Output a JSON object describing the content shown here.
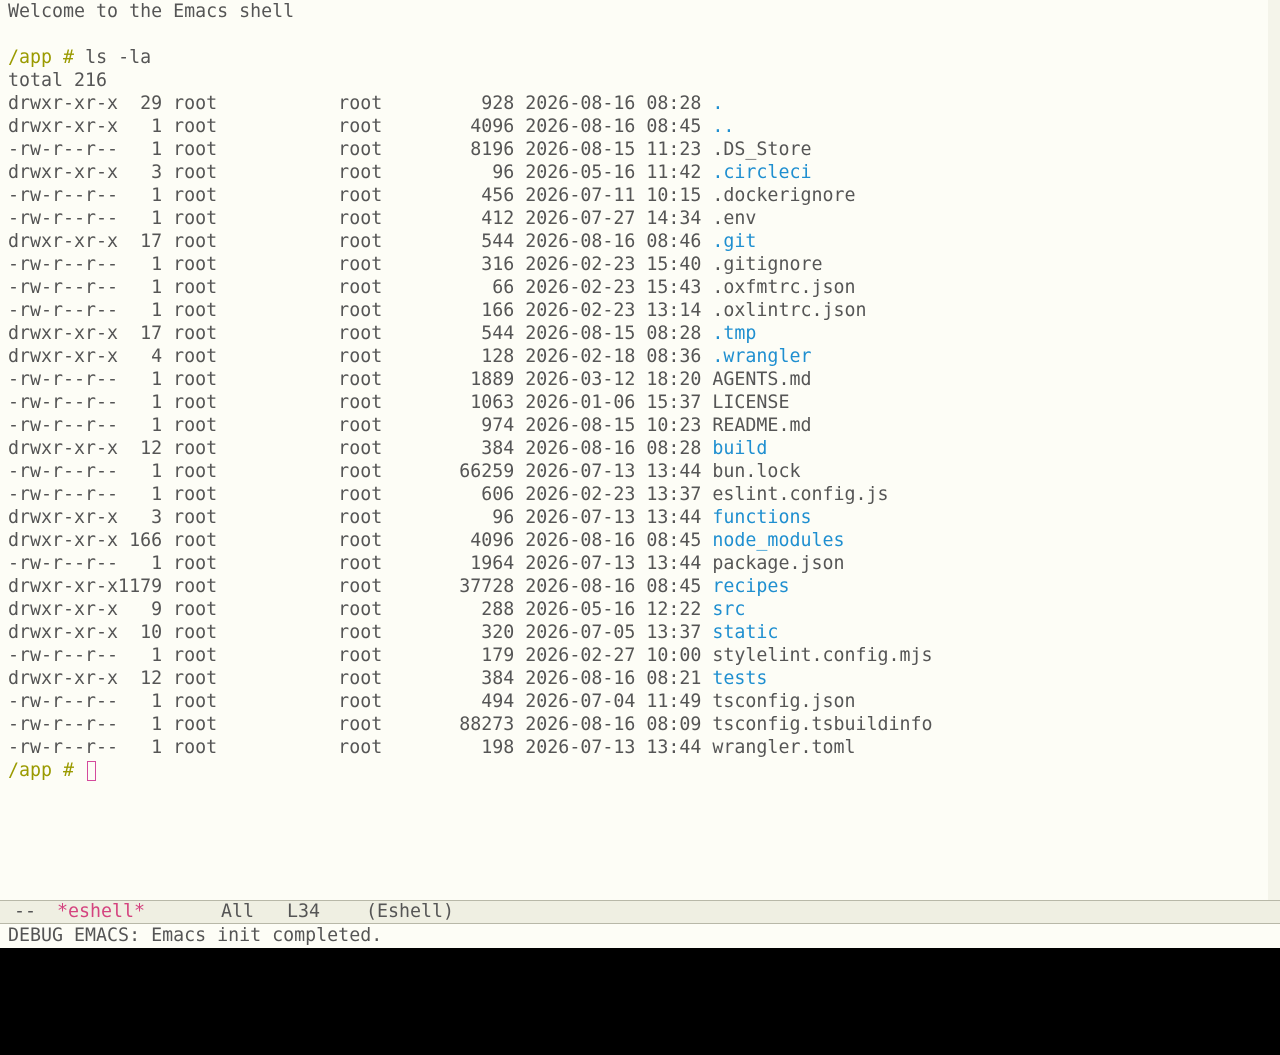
{
  "welcome": "Welcome to the Emacs shell",
  "prompt": "/app #",
  "command": "ls -la",
  "total": "total 216",
  "entries": [
    {
      "perms": "drwxr-xr-x",
      "links": "29",
      "owner": "root",
      "group": "root",
      "size": "928",
      "date": "2026-08-16 08:28",
      "name": ".",
      "dir": true
    },
    {
      "perms": "drwxr-xr-x",
      "links": "1",
      "owner": "root",
      "group": "root",
      "size": "4096",
      "date": "2026-08-16 08:45",
      "name": "..",
      "dir": true
    },
    {
      "perms": "-rw-r--r--",
      "links": "1",
      "owner": "root",
      "group": "root",
      "size": "8196",
      "date": "2026-08-15 11:23",
      "name": ".DS_Store",
      "dir": false
    },
    {
      "perms": "drwxr-xr-x",
      "links": "3",
      "owner": "root",
      "group": "root",
      "size": "96",
      "date": "2026-05-16 11:42",
      "name": ".circleci",
      "dir": true
    },
    {
      "perms": "-rw-r--r--",
      "links": "1",
      "owner": "root",
      "group": "root",
      "size": "456",
      "date": "2026-07-11 10:15",
      "name": ".dockerignore",
      "dir": false
    },
    {
      "perms": "-rw-r--r--",
      "links": "1",
      "owner": "root",
      "group": "root",
      "size": "412",
      "date": "2026-07-27 14:34",
      "name": ".env",
      "dir": false
    },
    {
      "perms": "drwxr-xr-x",
      "links": "17",
      "owner": "root",
      "group": "root",
      "size": "544",
      "date": "2026-08-16 08:46",
      "name": ".git",
      "dir": true
    },
    {
      "perms": "-rw-r--r--",
      "links": "1",
      "owner": "root",
      "group": "root",
      "size": "316",
      "date": "2026-02-23 15:40",
      "name": ".gitignore",
      "dir": false
    },
    {
      "perms": "-rw-r--r--",
      "links": "1",
      "owner": "root",
      "group": "root",
      "size": "66",
      "date": "2026-02-23 15:43",
      "name": ".oxfmtrc.json",
      "dir": false
    },
    {
      "perms": "-rw-r--r--",
      "links": "1",
      "owner": "root",
      "group": "root",
      "size": "166",
      "date": "2026-02-23 13:14",
      "name": ".oxlintrc.json",
      "dir": false
    },
    {
      "perms": "drwxr-xr-x",
      "links": "17",
      "owner": "root",
      "group": "root",
      "size": "544",
      "date": "2026-08-15 08:28",
      "name": ".tmp",
      "dir": true
    },
    {
      "perms": "drwxr-xr-x",
      "links": "4",
      "owner": "root",
      "group": "root",
      "size": "128",
      "date": "2026-02-18 08:36",
      "name": ".wrangler",
      "dir": true
    },
    {
      "perms": "-rw-r--r--",
      "links": "1",
      "owner": "root",
      "group": "root",
      "size": "1889",
      "date": "2026-03-12 18:20",
      "name": "AGENTS.md",
      "dir": false
    },
    {
      "perms": "-rw-r--r--",
      "links": "1",
      "owner": "root",
      "group": "root",
      "size": "1063",
      "date": "2026-01-06 15:37",
      "name": "LICENSE",
      "dir": false
    },
    {
      "perms": "-rw-r--r--",
      "links": "1",
      "owner": "root",
      "group": "root",
      "size": "974",
      "date": "2026-08-15 10:23",
      "name": "README.md",
      "dir": false
    },
    {
      "perms": "drwxr-xr-x",
      "links": "12",
      "owner": "root",
      "group": "root",
      "size": "384",
      "date": "2026-08-16 08:28",
      "name": "build",
      "dir": true
    },
    {
      "perms": "-rw-r--r--",
      "links": "1",
      "owner": "root",
      "group": "root",
      "size": "66259",
      "date": "2026-07-13 13:44",
      "name": "bun.lock",
      "dir": false
    },
    {
      "perms": "-rw-r--r--",
      "links": "1",
      "owner": "root",
      "group": "root",
      "size": "606",
      "date": "2026-02-23 13:37",
      "name": "eslint.config.js",
      "dir": false
    },
    {
      "perms": "drwxr-xr-x",
      "links": "3",
      "owner": "root",
      "group": "root",
      "size": "96",
      "date": "2026-07-13 13:44",
      "name": "functions",
      "dir": true
    },
    {
      "perms": "drwxr-xr-x",
      "links": "166",
      "owner": "root",
      "group": "root",
      "size": "4096",
      "date": "2026-08-16 08:45",
      "name": "node_modules",
      "dir": true
    },
    {
      "perms": "-rw-r--r--",
      "links": "1",
      "owner": "root",
      "group": "root",
      "size": "1964",
      "date": "2026-07-13 13:44",
      "name": "package.json",
      "dir": false
    },
    {
      "perms": "drwxr-xr-x",
      "links": "1179",
      "owner": "root",
      "group": "root",
      "size": "37728",
      "date": "2026-08-16 08:45",
      "name": "recipes",
      "dir": true
    },
    {
      "perms": "drwxr-xr-x",
      "links": "9",
      "owner": "root",
      "group": "root",
      "size": "288",
      "date": "2026-05-16 12:22",
      "name": "src",
      "dir": true
    },
    {
      "perms": "drwxr-xr-x",
      "links": "10",
      "owner": "root",
      "group": "root",
      "size": "320",
      "date": "2026-07-05 13:37",
      "name": "static",
      "dir": true
    },
    {
      "perms": "-rw-r--r--",
      "links": "1",
      "owner": "root",
      "group": "root",
      "size": "179",
      "date": "2026-02-27 10:00",
      "name": "stylelint.config.mjs",
      "dir": false
    },
    {
      "perms": "drwxr-xr-x",
      "links": "12",
      "owner": "root",
      "group": "root",
      "size": "384",
      "date": "2026-08-16 08:21",
      "name": "tests",
      "dir": true
    },
    {
      "perms": "-rw-r--r--",
      "links": "1",
      "owner": "root",
      "group": "root",
      "size": "494",
      "date": "2026-07-04 11:49",
      "name": "tsconfig.json",
      "dir": false
    },
    {
      "perms": "-rw-r--r--",
      "links": "1",
      "owner": "root",
      "group": "root",
      "size": "88273",
      "date": "2026-08-16 08:09",
      "name": "tsconfig.tsbuildinfo",
      "dir": false
    },
    {
      "perms": "-rw-r--r--",
      "links": "1",
      "owner": "root",
      "group": "root",
      "size": "198",
      "date": "2026-07-13 13:44",
      "name": "wrangler.toml",
      "dir": false
    }
  ],
  "modeline": {
    "status": "--",
    "buffer": "*eshell*",
    "position": "All",
    "line": "L34",
    "mode": "(Eshell)"
  },
  "echo": "DEBUG EMACS: Emacs init completed.",
  "colors": {
    "directory": "#1f8fd0",
    "prompt": "#9a9a00",
    "buffer_name": "#d4437f",
    "cursor": "#d44a9c",
    "text": "#555555"
  }
}
